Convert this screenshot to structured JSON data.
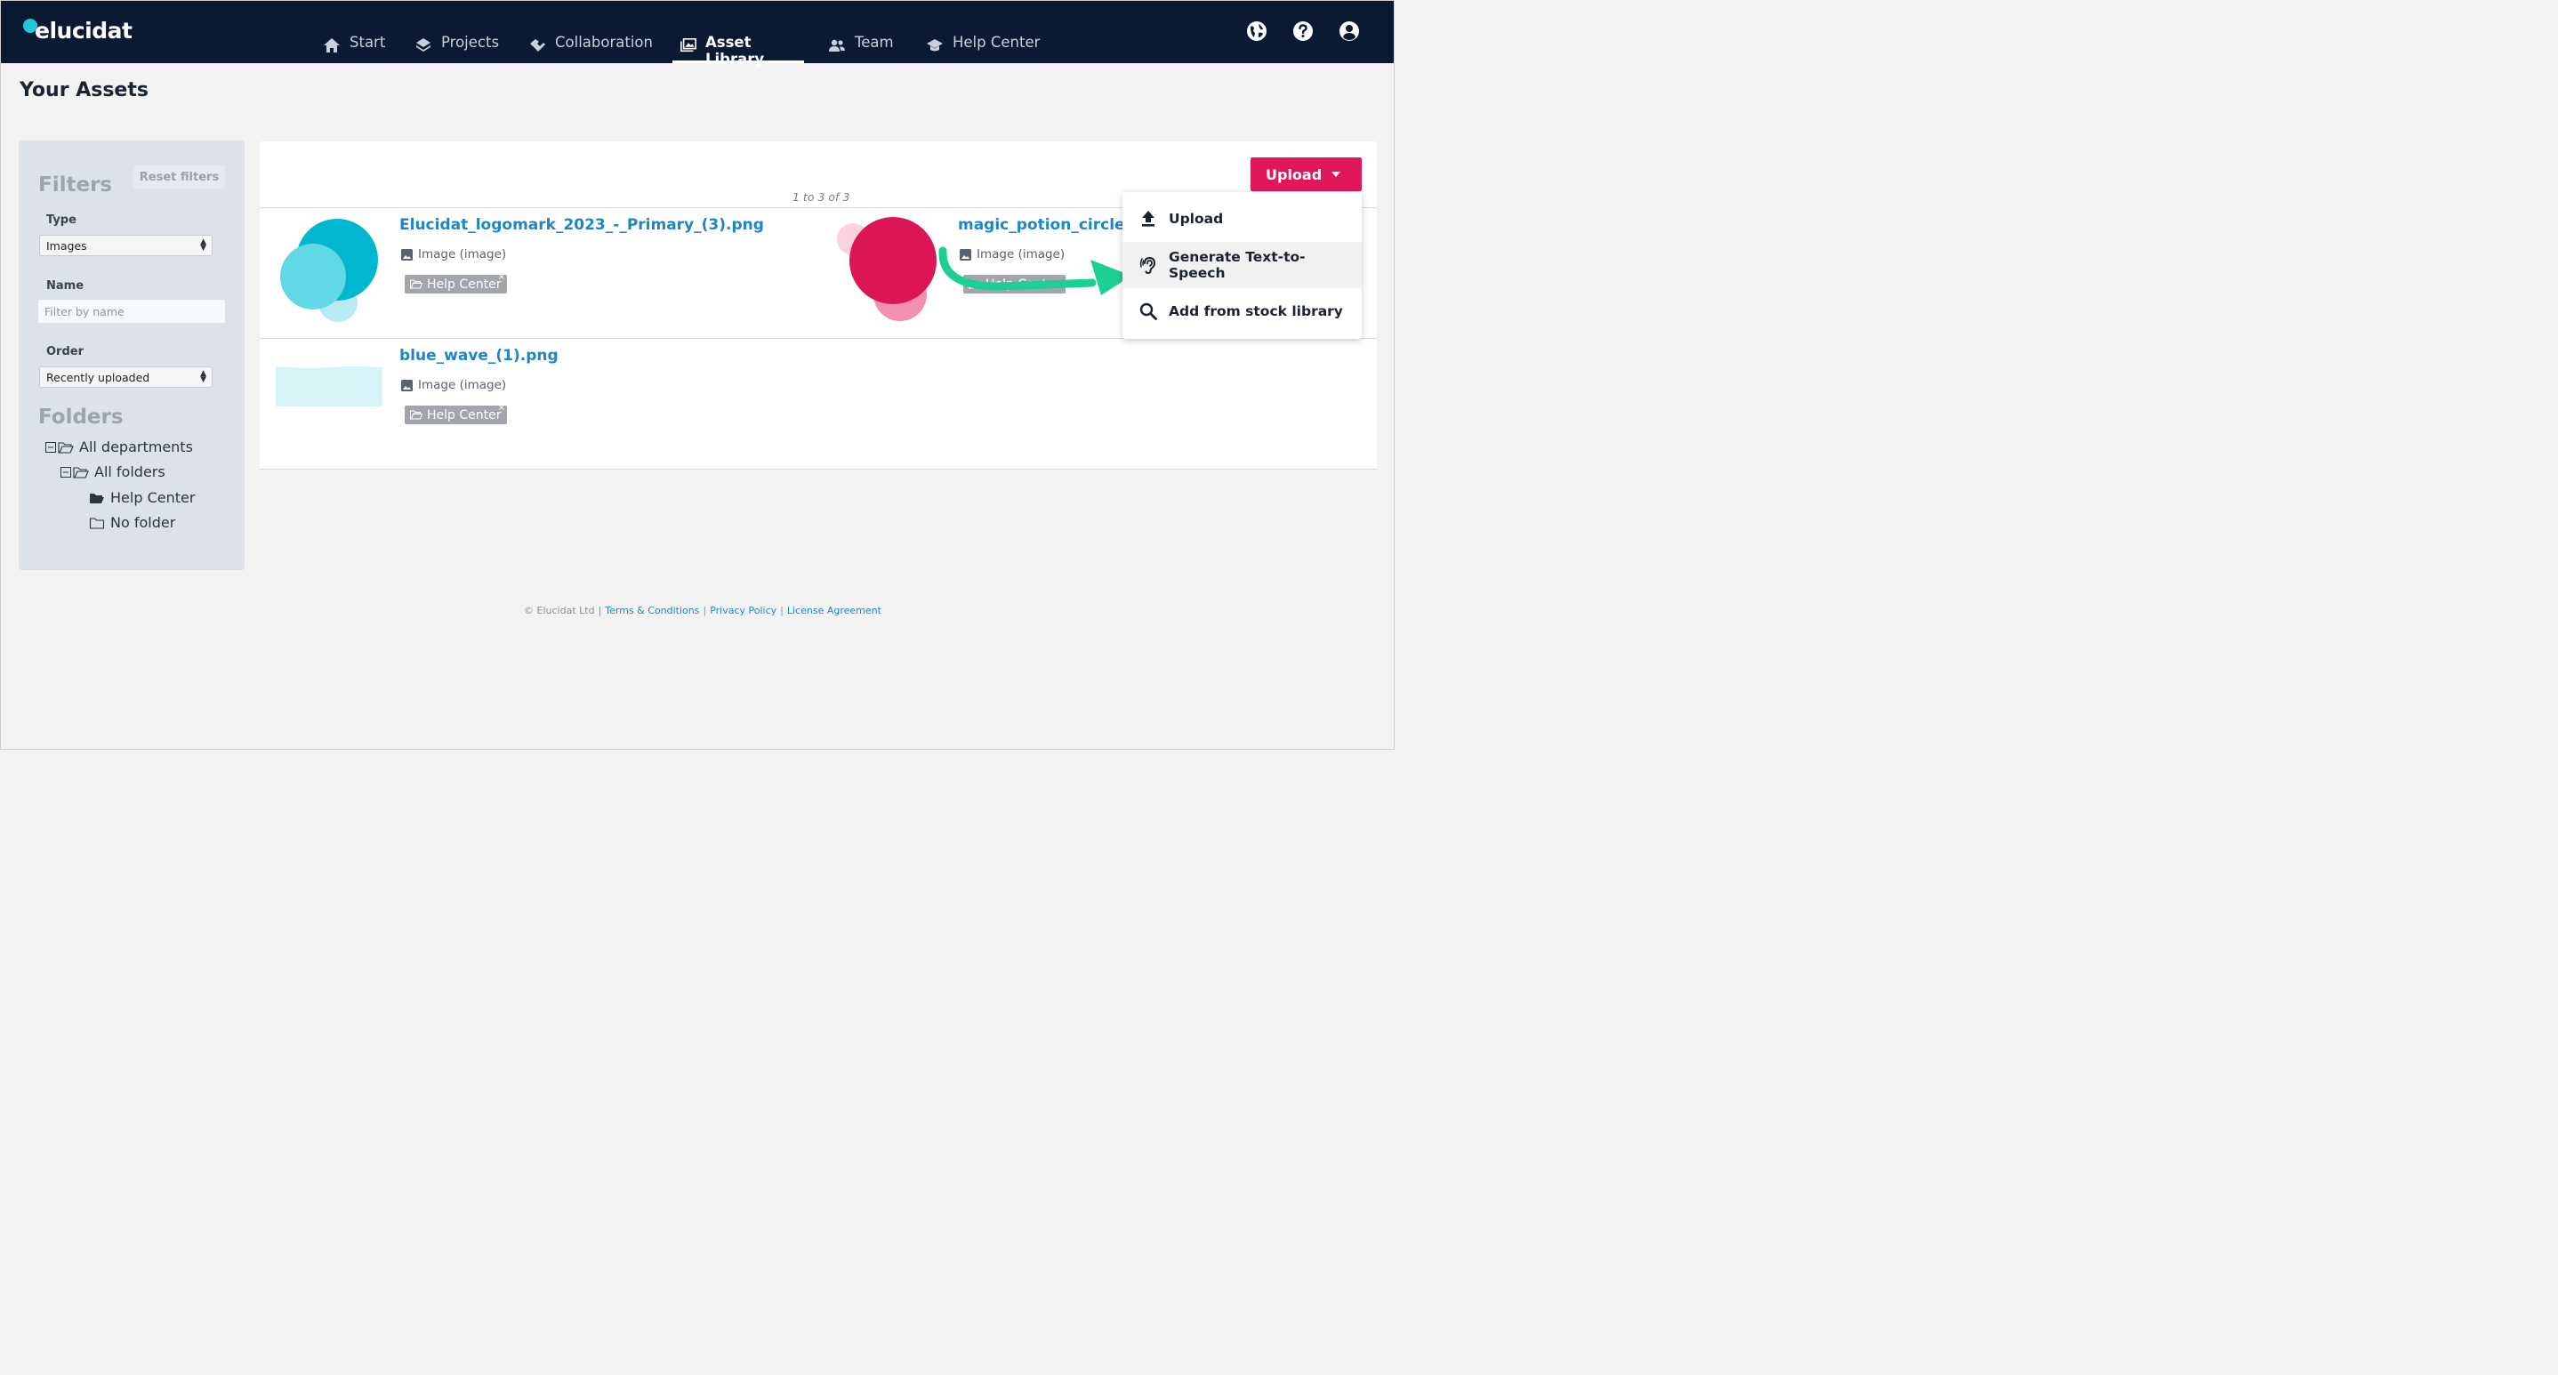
{
  "app": {
    "logo_text": "elucidat"
  },
  "nav": {
    "items": [
      {
        "label": "Start",
        "icon": "home-icon",
        "active": false
      },
      {
        "label": "Projects",
        "icon": "layers-icon",
        "active": false
      },
      {
        "label": "Collaboration",
        "icon": "handshake-icon",
        "active": false
      },
      {
        "label": "Asset Library",
        "icon": "images-icon",
        "active": true
      },
      {
        "label": "Team",
        "icon": "people-icon",
        "active": false
      },
      {
        "label": "Help Center",
        "icon": "graduation-cap-icon",
        "active": false
      }
    ],
    "right_icons": [
      "globe-icon",
      "help-icon",
      "account-icon"
    ]
  },
  "page": {
    "title": "Your Assets"
  },
  "sidebar": {
    "filters_heading": "Filters",
    "reset_label": "Reset filters",
    "type_label": "Type",
    "type_value": "Images",
    "name_label": "Name",
    "name_placeholder": "Filter by name",
    "order_label": "Order",
    "order_value": "Recently uploaded",
    "folders_heading": "Folders",
    "tree": [
      {
        "label": "All departments",
        "depth": 0,
        "open": true
      },
      {
        "label": "All folders",
        "depth": 1,
        "open": true
      },
      {
        "label": "Help Center",
        "depth": 2,
        "selected": true
      },
      {
        "label": "No folder",
        "depth": 2,
        "selected": false
      }
    ]
  },
  "main": {
    "pager_text": "1 to 3 of 3",
    "assets": [
      {
        "name": "Elucidat_logomark_2023_-_Primary_(3).png",
        "type": "Image (image)",
        "tag": "Help Center"
      },
      {
        "name": "magic_potion_circles",
        "type": "Image (image)",
        "tag": "Help Cente"
      },
      {
        "name": "blue_wave_(1).png",
        "type": "Image (image)",
        "tag": "Help Center"
      }
    ],
    "tag_remove": "×"
  },
  "upload": {
    "button_label": "Upload",
    "menu": [
      {
        "label": "Upload",
        "icon": "upload-icon",
        "highlighted": false
      },
      {
        "label": "Generate Text-to-Speech",
        "icon": "ear-icon",
        "highlighted": true
      },
      {
        "label": "Add from stock library",
        "icon": "search-icon",
        "highlighted": false
      }
    ]
  },
  "footer": {
    "copyright": "© Elucidat Ltd",
    "links": [
      "Terms & Conditions",
      "Privacy Policy",
      "License Agreement"
    ],
    "separator": "|"
  },
  "colors": {
    "nav_bg": "#0b1a33",
    "accent_pink": "#e0185a",
    "link_blue": "#1f86c6",
    "arrow_green": "#1ccf94"
  }
}
